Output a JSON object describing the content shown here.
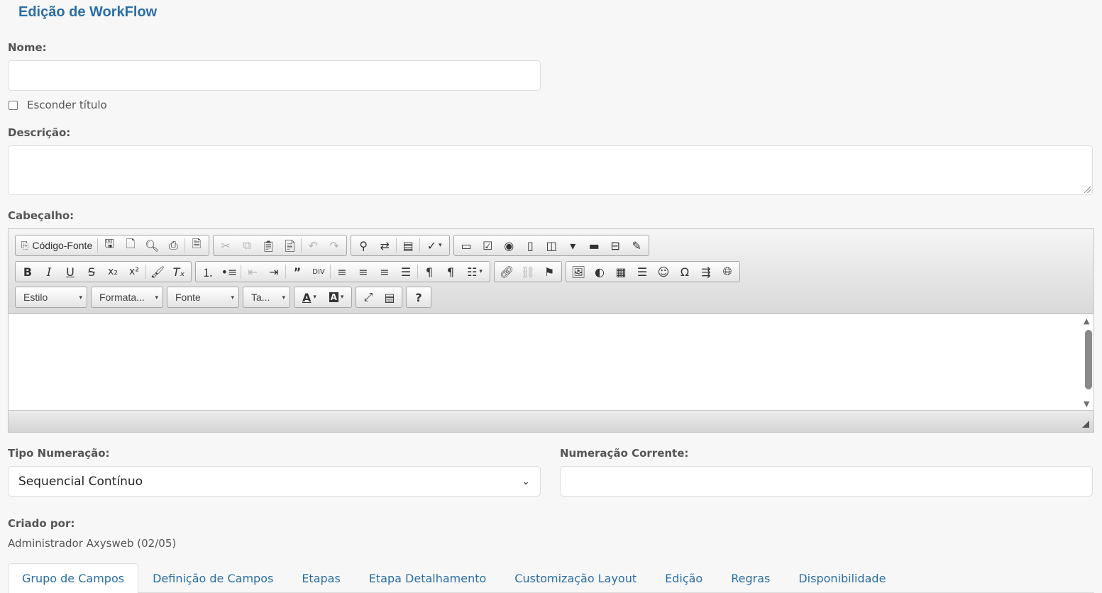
{
  "page_title": "Edição de WorkFlow",
  "nome": {
    "label": "Nome:",
    "value": ""
  },
  "hide_title": {
    "label": "Esconder título",
    "checked": false
  },
  "descricao": {
    "label": "Descrição:",
    "value": ""
  },
  "cabecalho": {
    "label": "Cabeçalho:",
    "source_button": "Código-Fonte",
    "combos": {
      "estilo": "Estilo",
      "formatacao": "Formata...",
      "fonte": "Fonte",
      "tamanho": "Ta..."
    },
    "content": ""
  },
  "tipo_numeracao": {
    "label": "Tipo Numeração:",
    "selected": "Sequencial Contínuo"
  },
  "numeracao_corrente": {
    "label": "Numeração Corrente:",
    "value": ""
  },
  "criado_por": {
    "label": "Criado por:",
    "value": "Administrador Axysweb (02/05)"
  },
  "tabs": [
    {
      "label": "Grupo de Campos",
      "active": true
    },
    {
      "label": "Definição de Campos"
    },
    {
      "label": "Etapas"
    },
    {
      "label": "Etapa Detalhamento"
    },
    {
      "label": "Customização Layout"
    },
    {
      "label": "Edição"
    },
    {
      "label": "Regras"
    },
    {
      "label": "Disponibilidade"
    }
  ],
  "colors": {
    "accent": "#2a6ea6",
    "background": "#f7f7f7",
    "border": "#dcdcdc"
  }
}
